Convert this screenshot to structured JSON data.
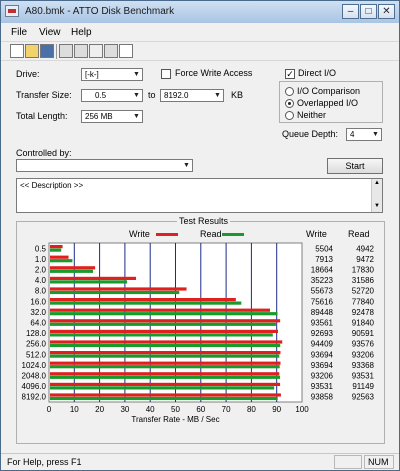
{
  "window": {
    "title": "A80.bmk - ATTO Disk Benchmark"
  },
  "title_buttons": {
    "minimize": "–",
    "maximize": "□",
    "close": "✕"
  },
  "menu": [
    "File",
    "View",
    "Help"
  ],
  "toolbar_icons": [
    "new-icon",
    "open-icon",
    "save-icon",
    "print-icon",
    "print-preview-icon",
    "move-icon",
    "copy-icon",
    "help-icon"
  ],
  "settings": {
    "drive_label": "Drive:",
    "drive_value": "[-k-]",
    "force_write_access": "Force Write Access",
    "direct_io": "Direct I/O",
    "direct_io_checked": true,
    "transfer_size_label": "Transfer Size:",
    "transfer_from": "0.5",
    "to_label": "to",
    "transfer_to": "8192.0",
    "kb_label": "KB",
    "total_length_label": "Total Length:",
    "total_length_value": "256 MB",
    "io_options": [
      "I/O Comparison",
      "Overlapped I/O",
      "Neither"
    ],
    "io_selected": "Overlapped I/O",
    "queue_depth_label": "Queue Depth:",
    "queue_depth_value": "4",
    "controlled_by_label": "Controlled by:",
    "controlled_by_value": "",
    "start_button": "Start",
    "description": "<< Description >>"
  },
  "results": {
    "title": "Test Results",
    "write_label": "Write",
    "read_label": "Read",
    "write_color": "#e02020",
    "read_color": "#1a9a2a",
    "col_write": "Write",
    "col_read": "Read"
  },
  "chart_data": {
    "type": "bar",
    "orientation": "horizontal",
    "categories": [
      "0.5",
      "1.0",
      "2.0",
      "4.0",
      "8.0",
      "16.0",
      "32.0",
      "64.0",
      "128.0",
      "256.0",
      "512.0",
      "1024.0",
      "2048.0",
      "4096.0",
      "8192.0"
    ],
    "series": [
      {
        "name": "Write",
        "values": [
          5504,
          7913,
          18664,
          35223,
          55673,
          75616,
          89448,
          93561,
          92693,
          94409,
          93694,
          93694,
          93206,
          93531,
          93858
        ]
      },
      {
        "name": "Read",
        "values": [
          4942,
          9472,
          17830,
          31586,
          52720,
          77840,
          92478,
          91840,
          90591,
          93576,
          93206,
          93368,
          93531,
          91149,
          92563
        ]
      }
    ],
    "xlabel": "Transfer Rate - MB / Sec",
    "xticks": [
      "0",
      "10",
      "20",
      "30",
      "40",
      "50",
      "60",
      "70",
      "80",
      "90",
      "100"
    ],
    "xlim": [
      0,
      100
    ],
    "grid": true,
    "legend": "top"
  },
  "status": {
    "help": "For Help, press F1",
    "num": "NUM"
  }
}
